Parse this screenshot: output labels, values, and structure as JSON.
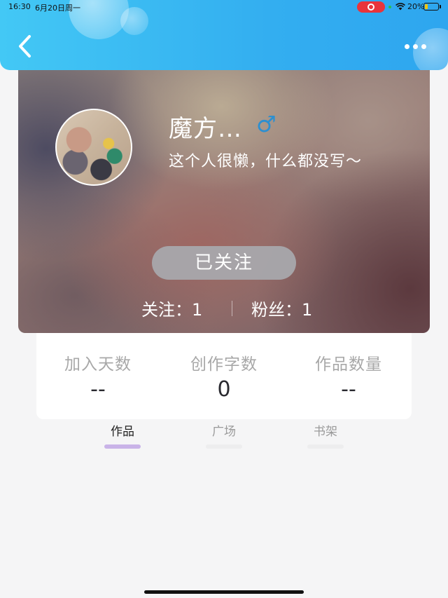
{
  "status_bar": {
    "time": "16:30",
    "date": "6月20日周一",
    "battery": "20%",
    "battery_level": 0.2,
    "recording_color": "#e8343b"
  },
  "header": {
    "back_icon": "chevron-left-icon",
    "more_icon": "more-dots-icon",
    "accent_color": "#33aef0"
  },
  "profile": {
    "username": "魔方…",
    "gender_symbol": "♂",
    "gender_color": "#2d8fd0",
    "bio": "这个人很懒，什么都没写～",
    "follow_button": "已关注",
    "following_label": "关注：1",
    "fans_label": "粉丝：1"
  },
  "stats": [
    {
      "label": "加入天数",
      "value": "--"
    },
    {
      "label": "创作字数",
      "value": "0"
    },
    {
      "label": "作品数量",
      "value": "--"
    }
  ],
  "tabs": [
    {
      "label": "作品",
      "active": true
    },
    {
      "label": "广场",
      "active": false
    },
    {
      "label": "书架",
      "active": false
    }
  ]
}
